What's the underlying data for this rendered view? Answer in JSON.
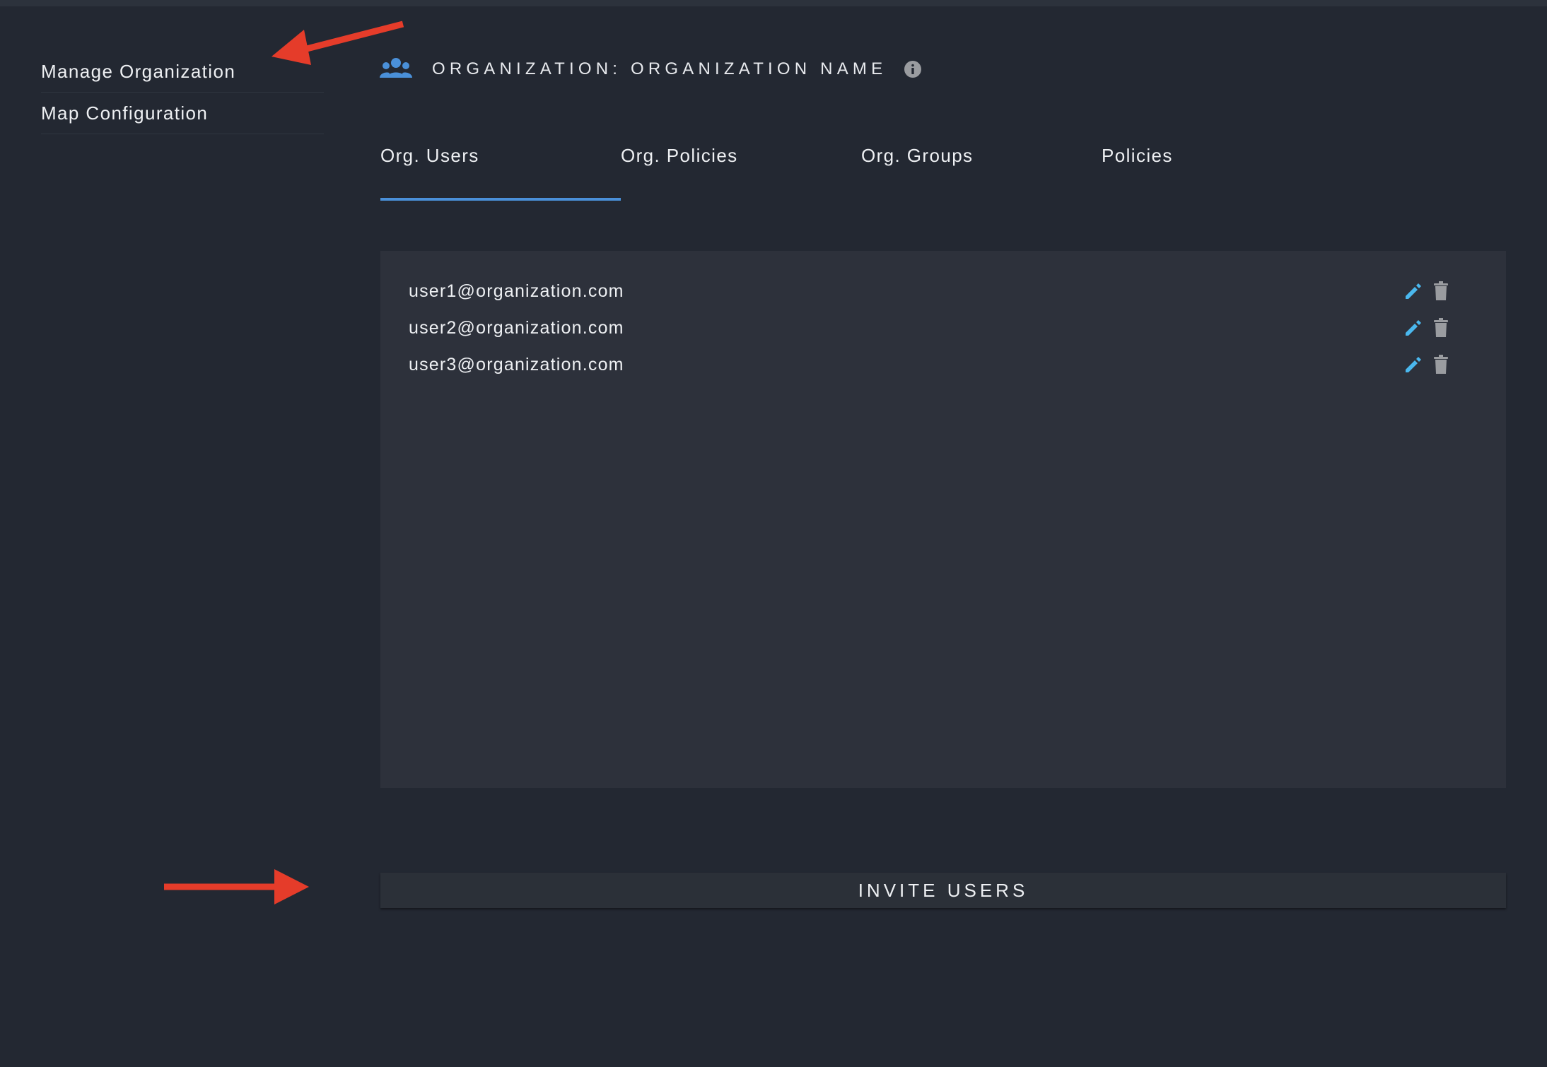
{
  "sidebar": {
    "items": [
      {
        "label": "Manage Organization"
      },
      {
        "label": "Map Configuration"
      }
    ]
  },
  "header": {
    "title": "ORGANIZATION: ORGANIZATION NAME",
    "icon": "group-icon",
    "info_icon": "info-icon"
  },
  "tabs": [
    {
      "label": "Org. Users",
      "active": true
    },
    {
      "label": "Org. Policies",
      "active": false
    },
    {
      "label": "Org. Groups",
      "active": false
    },
    {
      "label": "Policies",
      "active": false
    }
  ],
  "users": [
    {
      "email": "user1@organization.com"
    },
    {
      "email": "user2@organization.com"
    },
    {
      "email": "user3@organization.com"
    }
  ],
  "invite_button": {
    "label": "INVITE USERS"
  },
  "colors": {
    "background": "#232832",
    "panel": "#2d313b",
    "accent": "#4a90d9",
    "edit_icon": "#4ab8ee",
    "delete_icon": "#9a9ca0",
    "annotation_arrow": "#e53c2a"
  }
}
